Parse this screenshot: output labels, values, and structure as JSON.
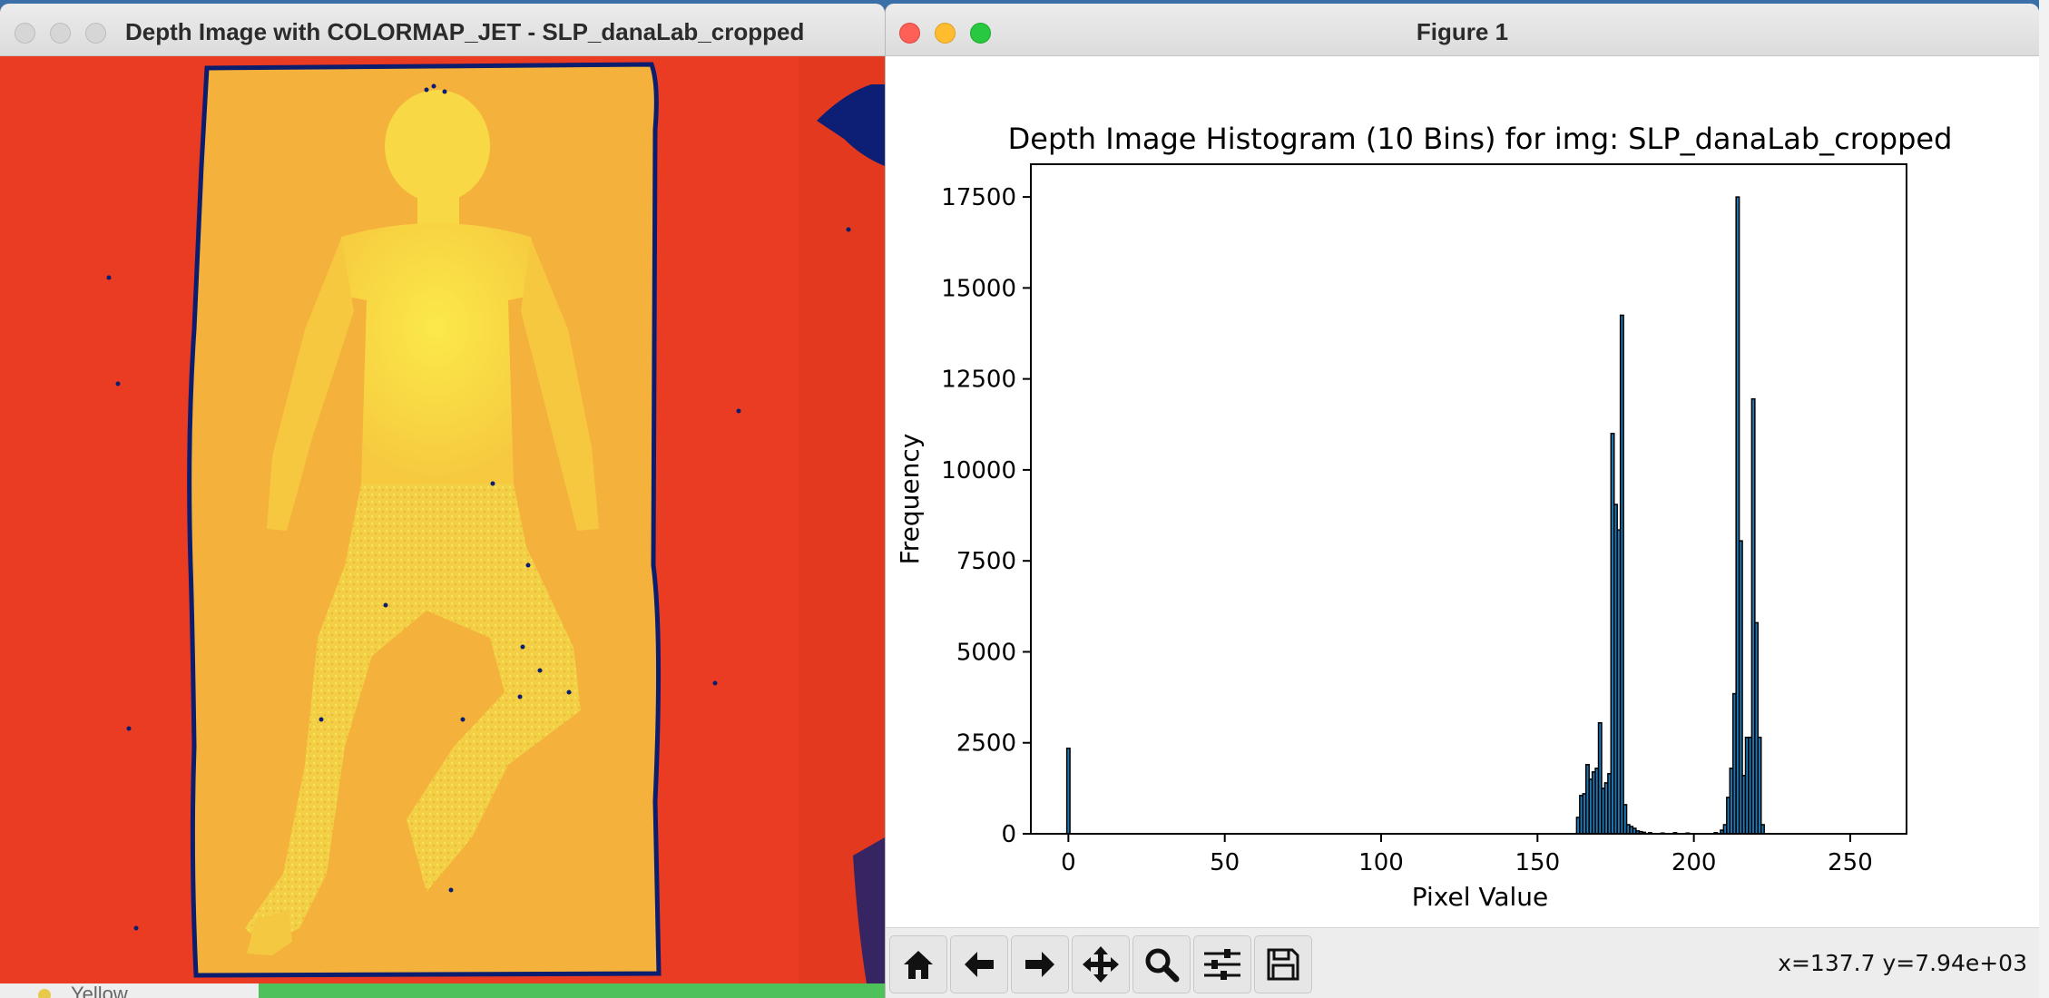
{
  "desktop": {
    "bottom_label": "Yellow"
  },
  "depth_window": {
    "title": "Depth Image with COLORMAP_JET - SLP_danaLab_cropped",
    "colors": {
      "background": "#ea3b23",
      "bed": "#f4b13c",
      "body": "#f8d845",
      "edge": "#0b1d6e"
    }
  },
  "figure_window": {
    "title": "Figure 1",
    "toolbar": {
      "buttons": [
        "home-icon",
        "back-arrow-icon",
        "forward-arrow-icon",
        "pan-move-icon",
        "zoom-magnifier-icon",
        "configure-subplots-icon",
        "save-disk-icon"
      ],
      "coordinates": "x=137.7 y=7.94e+03"
    }
  },
  "chart_data": {
    "type": "bar",
    "title": "Depth Image Histogram (10 Bins) for img: SLP_danaLab_cropped",
    "xlabel": "Pixel Value",
    "ylabel": "Frequency",
    "xlim": [
      -12,
      268
    ],
    "ylim": [
      0,
      18400
    ],
    "bin_width": 1,
    "x_ticks": [
      0,
      50,
      100,
      150,
      200,
      250
    ],
    "y_ticks": [
      0,
      2500,
      5000,
      7500,
      10000,
      12500,
      15000,
      17500
    ],
    "bar_color": "#1f77b4",
    "edge_color": "#000000",
    "bins": [
      {
        "x": 0,
        "y": 2350
      },
      {
        "x": 163,
        "y": 450
      },
      {
        "x": 164,
        "y": 1050
      },
      {
        "x": 165,
        "y": 1100
      },
      {
        "x": 166,
        "y": 1900
      },
      {
        "x": 167,
        "y": 1500
      },
      {
        "x": 168,
        "y": 1700
      },
      {
        "x": 169,
        "y": 1800
      },
      {
        "x": 170,
        "y": 3050
      },
      {
        "x": 171,
        "y": 1250
      },
      {
        "x": 172,
        "y": 1400
      },
      {
        "x": 173,
        "y": 1650
      },
      {
        "x": 174,
        "y": 11000
      },
      {
        "x": 175,
        "y": 9050
      },
      {
        "x": 176,
        "y": 8350
      },
      {
        "x": 177,
        "y": 14250
      },
      {
        "x": 178,
        "y": 800
      },
      {
        "x": 179,
        "y": 250
      },
      {
        "x": 180,
        "y": 200
      },
      {
        "x": 181,
        "y": 150
      },
      {
        "x": 182,
        "y": 80
      },
      {
        "x": 183,
        "y": 60
      },
      {
        "x": 184,
        "y": 40
      },
      {
        "x": 186,
        "y": 30
      },
      {
        "x": 190,
        "y": 20
      },
      {
        "x": 194,
        "y": 30
      },
      {
        "x": 198,
        "y": 20
      },
      {
        "x": 207,
        "y": 30
      },
      {
        "x": 209,
        "y": 100
      },
      {
        "x": 210,
        "y": 250
      },
      {
        "x": 211,
        "y": 1000
      },
      {
        "x": 212,
        "y": 1800
      },
      {
        "x": 213,
        "y": 3850
      },
      {
        "x": 214,
        "y": 17500
      },
      {
        "x": 215,
        "y": 8050
      },
      {
        "x": 216,
        "y": 1600
      },
      {
        "x": 217,
        "y": 2650
      },
      {
        "x": 218,
        "y": 2650
      },
      {
        "x": 219,
        "y": 11950
      },
      {
        "x": 220,
        "y": 5800
      },
      {
        "x": 221,
        "y": 2650
      },
      {
        "x": 222,
        "y": 250
      }
    ]
  }
}
